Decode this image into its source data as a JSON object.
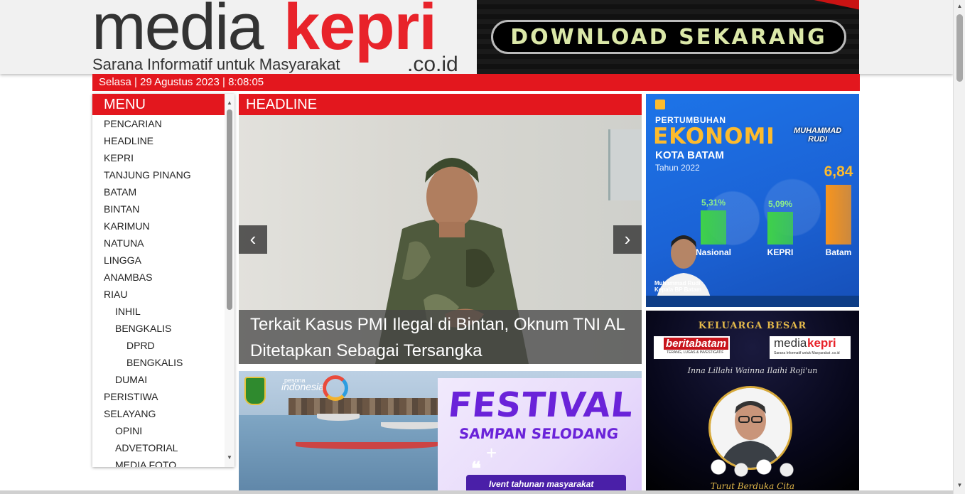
{
  "header": {
    "logo_media": "media",
    "logo_kepri": "kepri",
    "logo_domain": ".co.id",
    "tagline": "Sarana Informatif untuk Masyarakat",
    "banner_text": "DOWNLOAD SEKARANG",
    "date_text": "Selasa | 29 Agustus 2023 | 8:08:05"
  },
  "menu": {
    "title": "MENU",
    "items": [
      {
        "label": "PENCARIAN",
        "level": 0
      },
      {
        "label": "HEADLINE",
        "level": 0
      },
      {
        "label": "KEPRI",
        "level": 0
      },
      {
        "label": "TANJUNG PINANG",
        "level": 0
      },
      {
        "label": "BATAM",
        "level": 0
      },
      {
        "label": "BINTAN",
        "level": 0
      },
      {
        "label": "KARIMUN",
        "level": 0
      },
      {
        "label": "NATUNA",
        "level": 0
      },
      {
        "label": "LINGGA",
        "level": 0
      },
      {
        "label": "ANAMBAS",
        "level": 0
      },
      {
        "label": "RIAU",
        "level": 0
      },
      {
        "label": "INHIL",
        "level": 1
      },
      {
        "label": "BENGKALIS",
        "level": 1
      },
      {
        "label": "DPRD",
        "level": 2
      },
      {
        "label": "BENGKALIS",
        "level": 2
      },
      {
        "label": "DUMAI",
        "level": 1
      },
      {
        "label": "PERISTIWA",
        "level": 0
      },
      {
        "label": "SELAYANG",
        "level": 0
      },
      {
        "label": "OPINI",
        "level": 1
      },
      {
        "label": "ADVETORIAL",
        "level": 1
      },
      {
        "label": "MEDIA FOTO",
        "level": 1
      }
    ]
  },
  "headline": {
    "title": "HEADLINE",
    "slide_caption": "Terkait Kasus PMI Ilegal di Bintan, Oknum TNI AL Ditetapkan Sebagai Tersangka",
    "prev_icon": "‹",
    "next_icon": "›"
  },
  "festival": {
    "title": "FESTIVAL",
    "subtitle": "SAMPAN SELODANG",
    "plus": "+",
    "quote": "❝",
    "pill": "Ivent tahunan masyarakat",
    "pesona_small": "pesona",
    "pesona": "indonesia"
  },
  "ad_economy": {
    "small_title": "PERTUMBUHAN",
    "big_title": "EKONOMI",
    "city": "KOTA BATAM",
    "year": "Tahun 2022",
    "person_name_1": "MUHAMMAD",
    "person_name_2": "RUDI",
    "caption_1": "Muhammad Rudi",
    "caption_2": "Kepala BP Batam",
    "chart_data": {
      "type": "bar",
      "categories": [
        "Nasional",
        "KEPRI",
        "Batam"
      ],
      "values": [
        5.31,
        5.09,
        6.84
      ],
      "value_labels": [
        "5,31%",
        "5,09%",
        "6,84"
      ],
      "colors": [
        "#3fd14a",
        "#3fd14a",
        "#f7941d"
      ]
    }
  },
  "ad_condolence": {
    "title": "KELUARGA BESAR",
    "beritabatam": "beritabatam",
    "beritabatam_sub": "TERANG, LUGAS & INVESTIGATIF",
    "mk_media": "media",
    "mk_kepri": "kepri",
    "mk_sub": "Sarana Informatif untuk Masyarakat .co.id",
    "arabic": "Inna Lillahi Wainna Ilaihi Roji'un",
    "bottom": "Turut Berduka Cita"
  },
  "colors": {
    "brand_red": "#e3171e",
    "accent_purple": "#6a23d9",
    "gold": "#e2b84a"
  }
}
